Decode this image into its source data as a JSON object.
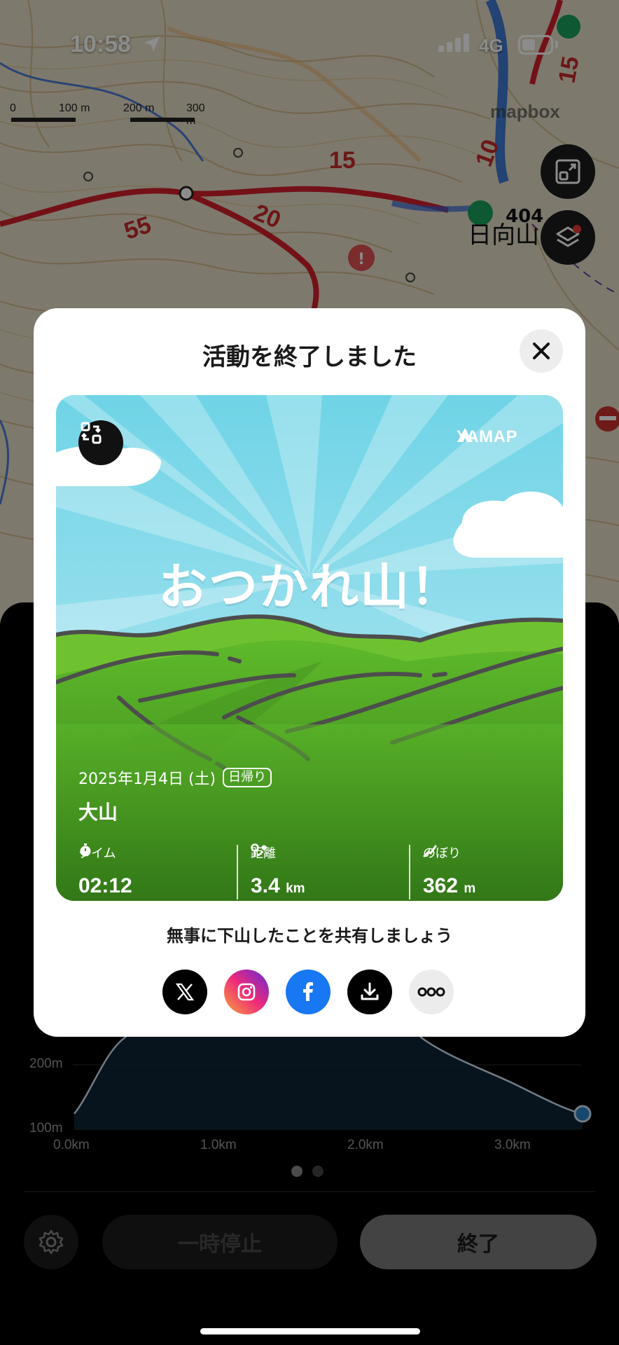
{
  "status_bar": {
    "time": "10:58",
    "network": "4G"
  },
  "map": {
    "scale": {
      "labels": [
        "0",
        "100 m",
        "200 m",
        "300 m"
      ]
    },
    "attribution": "mapbox",
    "peak_label": "日向山",
    "peak_height": "404",
    "route_labels": [
      "55",
      "20",
      "15",
      "10",
      "15"
    ]
  },
  "modal": {
    "title": "活動を終了しました",
    "card": {
      "brand": "YAMAP",
      "headline": "おつかれ山！",
      "date": "2025年1月4日 (土)",
      "trip_type": "日帰り",
      "mountain": "大山",
      "stats": [
        {
          "label": "タイム",
          "value": "02:12",
          "unit": ""
        },
        {
          "label": "距離",
          "value": "3.4",
          "unit": "km"
        },
        {
          "label": "のぼり",
          "value": "362",
          "unit": "m"
        }
      ]
    },
    "share_prompt": "無事に下山したことを共有しましょう",
    "share_buttons": [
      "x-share",
      "instagram-share",
      "facebook-share",
      "download",
      "more"
    ]
  },
  "elevation_chart": {
    "y_ticks": [
      "200m",
      "100m"
    ],
    "x_ticks": [
      "0.0km",
      "1.0km",
      "2.0km",
      "3.0km"
    ]
  },
  "controls": {
    "pause_label": "一時停止",
    "end_label": "終了"
  }
}
